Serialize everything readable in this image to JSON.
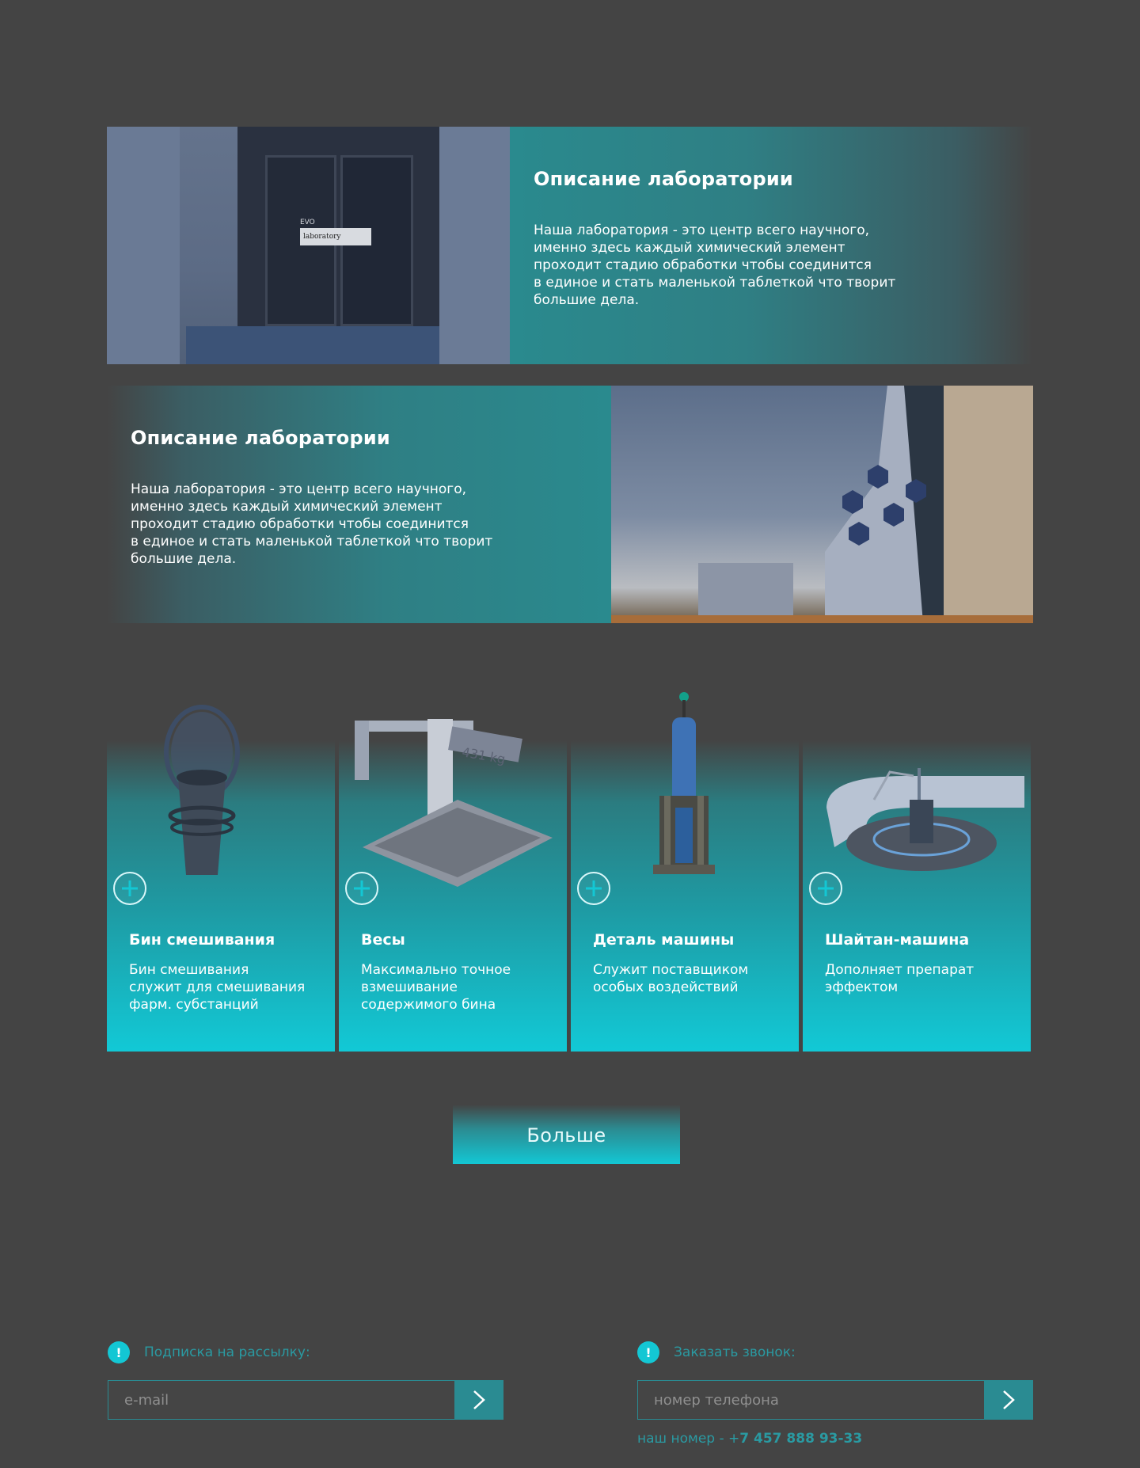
{
  "labs": [
    {
      "title": "Описание лаборатории",
      "text": "Наша лаборатория - это центр всего научного,\nименно здесь каждый химический элемент\nпроходит стадию обработки чтобы соединится\nв единое и стать маленькой таблеткой что творит\nбольшие дела.",
      "image_sign_top": "EVO",
      "image_sign": "laboratory"
    },
    {
      "title": "Описание лаборатории",
      "text": "Наша лаборатория - это центр всего научного,\nименно здесь каждый химический элемент\nпроходит стадию обработки чтобы соединится\nв единое и стать маленькой таблеткой что творит\nбольшие дела."
    }
  ],
  "cards": [
    {
      "title": "Бин смешивания",
      "desc": "Бин смешивания\nслужит для смешивания\nфарм. субстанций",
      "icon": "mixing-bin-icon"
    },
    {
      "title": "Весы",
      "desc": "Максимально точное\nвзмешивание\nсодержимого бина",
      "icon": "scales-icon",
      "scale_label": "431 kg"
    },
    {
      "title": "Деталь машины",
      "desc": "Служит поставщиком\nособых воздействий",
      "icon": "machine-part-icon"
    },
    {
      "title": "Шайтан-машина",
      "desc": "Дополняет препарат\nэффектом",
      "icon": "shaitan-machine-icon"
    }
  ],
  "more_button": "Больше",
  "subscribe": {
    "label": "Подписка на рассылку:",
    "placeholder": "e-mail",
    "alert": "!"
  },
  "callback": {
    "label": "Заказать звонок:",
    "placeholder": "номер телефона",
    "alert": "!",
    "note_prefix": "наш номер - +",
    "note_number": "7 457 888 93-33"
  },
  "colors": {
    "background": "#444444",
    "accent": "#13c7d4",
    "accent_dark": "#2a8b92"
  }
}
